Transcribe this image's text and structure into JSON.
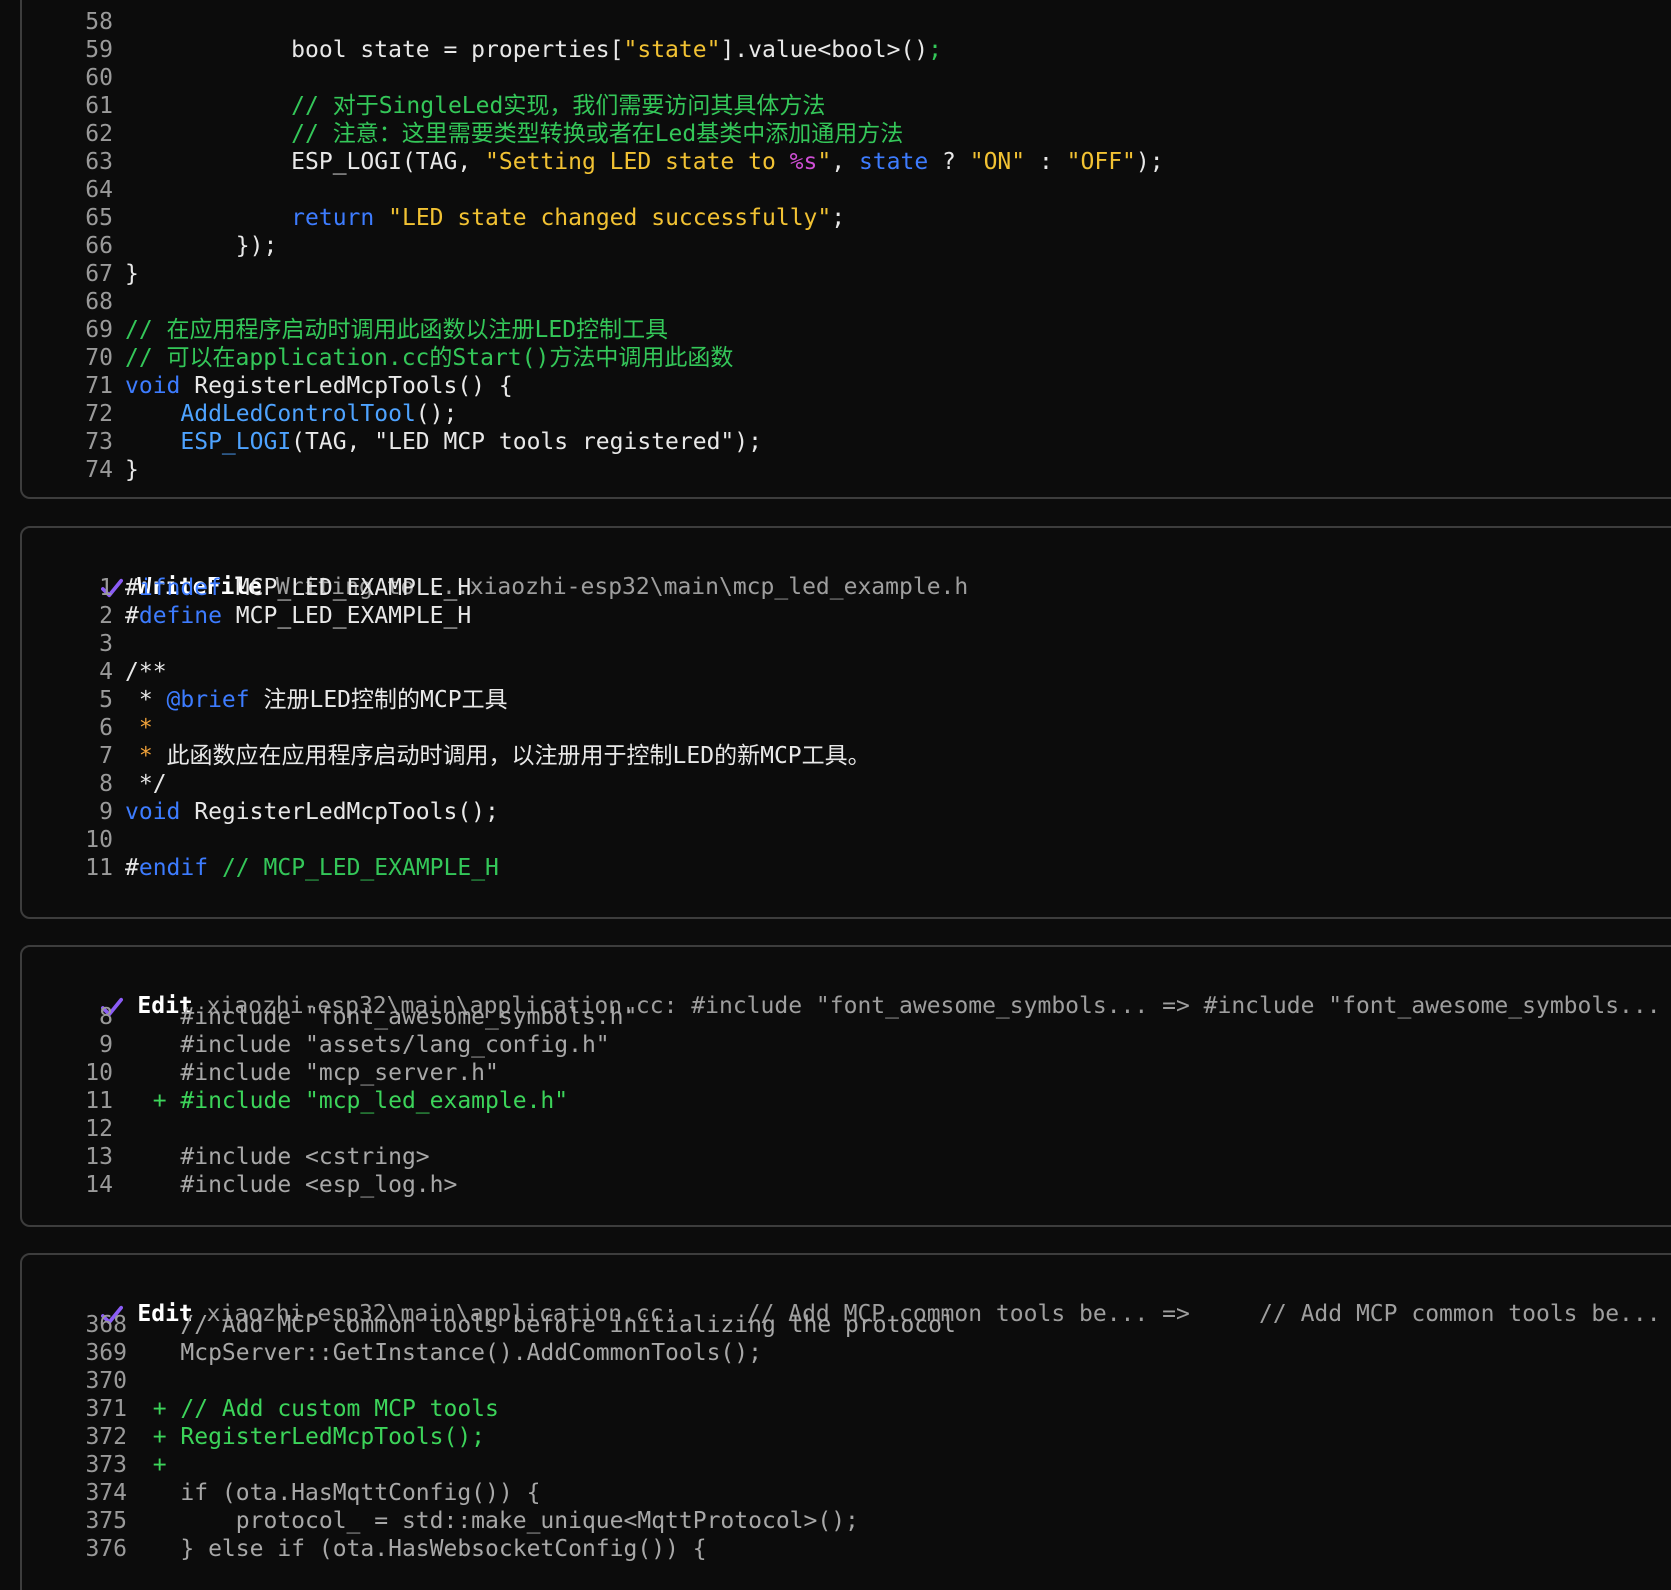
{
  "panel1": {
    "lines": [
      {
        "n": "58",
        "parts": []
      },
      {
        "n": "59",
        "parts": [
          {
            "t": "            bool state = properties[",
            "c": "plain"
          },
          {
            "t": "\"state\"",
            "c": "str"
          },
          {
            "t": "].value<bool>()",
            "c": "plain"
          },
          {
            "t": ";",
            "c": "pun"
          }
        ]
      },
      {
        "n": "60",
        "parts": []
      },
      {
        "n": "61",
        "parts": [
          {
            "t": "            // 对于SingleLed实现，我们需要访问其具体方法",
            "c": "cm"
          }
        ]
      },
      {
        "n": "62",
        "parts": [
          {
            "t": "            // 注意：这里需要类型转换或者在Led基类中添加通用方法",
            "c": "cm"
          }
        ]
      },
      {
        "n": "63",
        "parts": [
          {
            "t": "            ESP_LOGI(TAG, ",
            "c": "plain"
          },
          {
            "t": "\"Setting LED state to ",
            "c": "str"
          },
          {
            "t": "%s",
            "c": "fmt"
          },
          {
            "t": "\"",
            "c": "str"
          },
          {
            "t": ", ",
            "c": "plain"
          },
          {
            "t": "state",
            "c": "kw"
          },
          {
            "t": " ? ",
            "c": "plain"
          },
          {
            "t": "\"ON\"",
            "c": "str"
          },
          {
            "t": " : ",
            "c": "plain"
          },
          {
            "t": "\"OFF\"",
            "c": "str"
          },
          {
            "t": ");",
            "c": "plain"
          }
        ]
      },
      {
        "n": "64",
        "parts": []
      },
      {
        "n": "65",
        "parts": [
          {
            "t": "            ",
            "c": "plain"
          },
          {
            "t": "return",
            "c": "kw"
          },
          {
            "t": " ",
            "c": "plain"
          },
          {
            "t": "\"LED state changed successfully\"",
            "c": "str"
          },
          {
            "t": ";",
            "c": "plain"
          }
        ]
      },
      {
        "n": "66",
        "parts": [
          {
            "t": "        });",
            "c": "plain"
          }
        ]
      },
      {
        "n": "67",
        "parts": [
          {
            "t": "}",
            "c": "plain"
          }
        ]
      },
      {
        "n": "68",
        "parts": []
      },
      {
        "n": "69",
        "parts": [
          {
            "t": "// 在应用程序启动时调用此函数以注册LED控制工具",
            "c": "cm"
          }
        ]
      },
      {
        "n": "70",
        "parts": [
          {
            "t": "// 可以在application.cc的Start()方法中调用此函数",
            "c": "cm"
          }
        ]
      },
      {
        "n": "71",
        "parts": [
          {
            "t": "void",
            "c": "kw"
          },
          {
            "t": " RegisterLedMcpTools() {",
            "c": "plain"
          }
        ]
      },
      {
        "n": "72",
        "parts": [
          {
            "t": "    ",
            "c": "plain"
          },
          {
            "t": "AddLedControlTool",
            "c": "fn"
          },
          {
            "t": "();",
            "c": "plain"
          }
        ]
      },
      {
        "n": "73",
        "parts": [
          {
            "t": "    ",
            "c": "plain"
          },
          {
            "t": "ESP_LOGI",
            "c": "fn"
          },
          {
            "t": "(TAG, \"LED MCP tools registered\");",
            "c": "plain"
          }
        ]
      },
      {
        "n": "74",
        "parts": [
          {
            "t": "}",
            "c": "plain"
          }
        ]
      }
    ]
  },
  "panel2": {
    "tool": "WriteFile",
    "desc": "Writing to ...xiaozhi-esp32\\main\\mcp_led_example.h",
    "lines": [
      {
        "n": "1",
        "parts": [
          {
            "t": "#",
            "c": "plain"
          },
          {
            "t": "ifndef",
            "c": "kw"
          },
          {
            "t": " MCP_LED_EXAMPLE_H",
            "c": "plain"
          }
        ]
      },
      {
        "n": "2",
        "parts": [
          {
            "t": "#",
            "c": "plain"
          },
          {
            "t": "define",
            "c": "kw"
          },
          {
            "t": " MCP_LED_EXAMPLE_H",
            "c": "plain"
          }
        ]
      },
      {
        "n": "3",
        "parts": []
      },
      {
        "n": "4",
        "parts": [
          {
            "t": "/**",
            "c": "plain"
          }
        ]
      },
      {
        "n": "5",
        "parts": [
          {
            "t": " * ",
            "c": "plain"
          },
          {
            "t": "@brief",
            "c": "kw"
          },
          {
            "t": " 注册LED控制的MCP工具",
            "c": "plain"
          }
        ]
      },
      {
        "n": "6",
        "parts": [
          {
            "t": " *",
            "c": "star"
          }
        ]
      },
      {
        "n": "7",
        "parts": [
          {
            "t": " *",
            "c": "star"
          },
          {
            "t": " 此函数应在应用程序启动时调用，以注册用于控制LED的新MCP工具。",
            "c": "plain"
          }
        ]
      },
      {
        "n": "8",
        "parts": [
          {
            "t": " */",
            "c": "plain"
          }
        ]
      },
      {
        "n": "9",
        "parts": [
          {
            "t": "void",
            "c": "kw"
          },
          {
            "t": " RegisterLedMcpTools();",
            "c": "plain"
          }
        ]
      },
      {
        "n": "10",
        "parts": []
      },
      {
        "n": "11",
        "parts": [
          {
            "t": "#",
            "c": "plain"
          },
          {
            "t": "endif",
            "c": "kw"
          },
          {
            "t": " // MCP_LED_EXAMPLE_H",
            "c": "cm"
          }
        ]
      }
    ]
  },
  "panel3": {
    "tool": "Edit",
    "desc": "xiaozhi-esp32\\main\\application.cc: #include \"font_awesome_symbols... => #include \"font_awesome_symbols...",
    "lines": [
      {
        "n": "8",
        "parts": [
          {
            "t": "    #include \"font_awesome_symbols.h\"",
            "c": "dim"
          }
        ]
      },
      {
        "n": "9",
        "parts": [
          {
            "t": "    #include \"assets/lang_config.h\"",
            "c": "dim"
          }
        ]
      },
      {
        "n": "10",
        "parts": [
          {
            "t": "    #include \"mcp_server.h\"",
            "c": "dim"
          }
        ]
      },
      {
        "n": "11",
        "parts": [
          {
            "t": "  + #include \"mcp_led_example.h\"",
            "c": "add"
          }
        ]
      },
      {
        "n": "12",
        "parts": []
      },
      {
        "n": "13",
        "parts": [
          {
            "t": "    #include <cstring>",
            "c": "dim"
          }
        ]
      },
      {
        "n": "14",
        "parts": [
          {
            "t": "    #include <esp_log.h>",
            "c": "dim"
          }
        ]
      }
    ]
  },
  "panel4": {
    "tool": "Edit",
    "desc": "xiaozhi-esp32\\main\\application.cc:     // Add MCP common tools be... =>     // Add MCP common tools be...",
    "lines": [
      {
        "n": "368",
        "parts": [
          {
            "t": "    // Add MCP common tools before initializing the protocol",
            "c": "dim"
          }
        ]
      },
      {
        "n": "369",
        "parts": [
          {
            "t": "    McpServer::GetInstance().AddCommonTools();",
            "c": "dim"
          }
        ]
      },
      {
        "n": "370",
        "parts": []
      },
      {
        "n": "371",
        "parts": [
          {
            "t": "  + // Add custom MCP tools",
            "c": "add"
          }
        ]
      },
      {
        "n": "372",
        "parts": [
          {
            "t": "  + RegisterLedMcpTools();",
            "c": "add"
          }
        ]
      },
      {
        "n": "373",
        "parts": [
          {
            "t": "  +",
            "c": "add"
          }
        ]
      },
      {
        "n": "374",
        "parts": [
          {
            "t": "    if (ota.HasMqttConfig()) {",
            "c": "dim"
          }
        ]
      },
      {
        "n": "375",
        "parts": [
          {
            "t": "        protocol_ = std::make_unique<MqttProtocol>();",
            "c": "dim"
          }
        ]
      },
      {
        "n": "376",
        "parts": [
          {
            "t": "    } else if (ota.HasWebsocketConfig()) {",
            "c": "dim"
          }
        ]
      }
    ]
  },
  "colors": {
    "check": "#8b5cf6",
    "keyword": "#3d7cff",
    "string": "#f2c233",
    "comment": "#34c759",
    "added": "#3cd45a",
    "border": "#3d3d3d"
  }
}
